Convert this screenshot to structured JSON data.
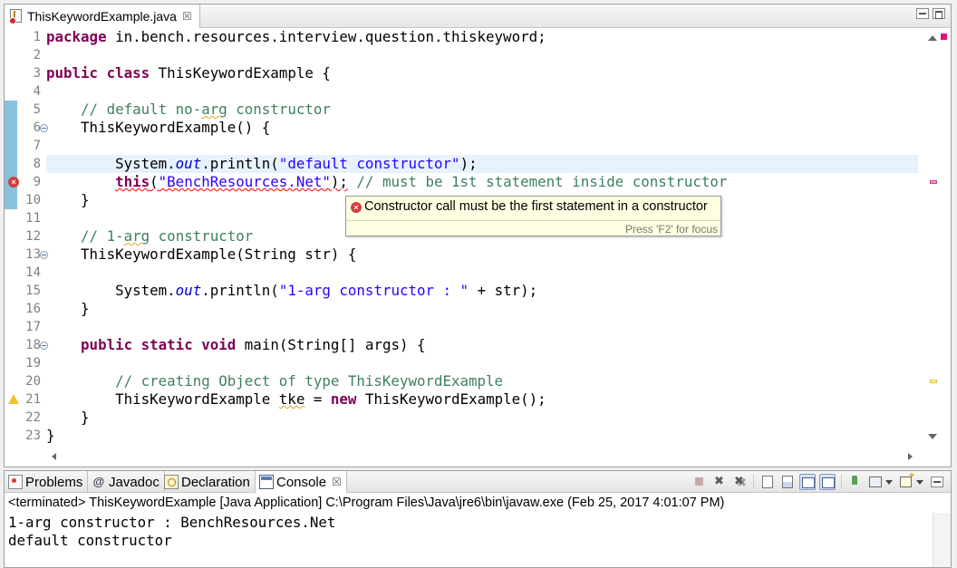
{
  "editor": {
    "tab_title": "ThisKeywordExample.java",
    "tab_close": "☒",
    "line_numbers": [
      "1",
      "2",
      "3",
      "4",
      "5",
      "6",
      "7",
      "8",
      "9",
      "10",
      "11",
      "12",
      "13",
      "14",
      "15",
      "16",
      "17",
      "18",
      "19",
      "20",
      "21",
      "22",
      "23"
    ],
    "code": {
      "l1": {
        "a": "package",
        "b": " in.bench.resources.interview.question.thiskeyword;"
      },
      "l3": {
        "a": "public",
        "b": " ",
        "c": "class",
        "d": " ThisKeywordExample {"
      },
      "l5": {
        "a": "// default no-",
        "b": "arg",
        "c": " constructor"
      },
      "l6": {
        "a": "ThisKeywordExample() {"
      },
      "l8": {
        "a": "System.",
        "b": "out",
        "c": ".println(",
        "d": "\"default constructor\"",
        "e": ");"
      },
      "l9": {
        "a": "this",
        "b": "(",
        "c": "\"BenchResources.Net\"",
        "d": ");",
        "e": " // must be 1st statement inside constructor"
      },
      "l10": {
        "a": "}"
      },
      "l12": {
        "a": "// 1-",
        "b": "arg",
        "c": " constructor"
      },
      "l13": {
        "a": "ThisKeywordExample(String str) {"
      },
      "l15": {
        "a": "System.",
        "b": "out",
        "c": ".println(",
        "d": "\"1-arg constructor : \"",
        "e": " + str);"
      },
      "l16": {
        "a": "}"
      },
      "l18": {
        "a": "public",
        "b": " ",
        "c": "static",
        "d": " ",
        "e": "void",
        "f": " main(String[] args) {"
      },
      "l20": {
        "a": "// creating Object of type ThisKeywordExample"
      },
      "l21": {
        "a": "ThisKeywordExample ",
        "b": "tke",
        "c": " = ",
        "d": "new",
        "e": " ThisKeywordExample();"
      },
      "l22": {
        "a": "}"
      },
      "l23": {
        "a": "}"
      }
    },
    "tooltip": {
      "message": "Constructor call must be the first statement in a constructor",
      "focus_hint": "Press 'F2' for focus"
    },
    "error_marker": "×"
  },
  "console": {
    "tabs": [
      {
        "label": "Problems"
      },
      {
        "label": "Javadoc"
      },
      {
        "label": "Declaration"
      },
      {
        "label": "Console"
      }
    ],
    "close": "☒",
    "status": "<terminated> ThisKeywordExample [Java Application] C:\\Program Files\\Java\\jre6\\bin\\javaw.exe (Feb 25, 2017 4:01:07 PM)",
    "output": [
      "1-arg constructor : BenchResources.Net",
      "default constructor"
    ]
  },
  "colors": {
    "keyword": "#7f0055",
    "comment": "#3f7f5f",
    "string": "#2a00ff",
    "field": "#0000c0",
    "error": "#d63c3c",
    "current_line": "#e8f2fe",
    "tooltip_bg": "#ffffe1"
  },
  "icons": {
    "editor_tab": "java-file-error-icon",
    "problems": "problems-icon",
    "javadoc": "javadoc-icon",
    "declaration": "declaration-icon",
    "console": "console-icon"
  }
}
